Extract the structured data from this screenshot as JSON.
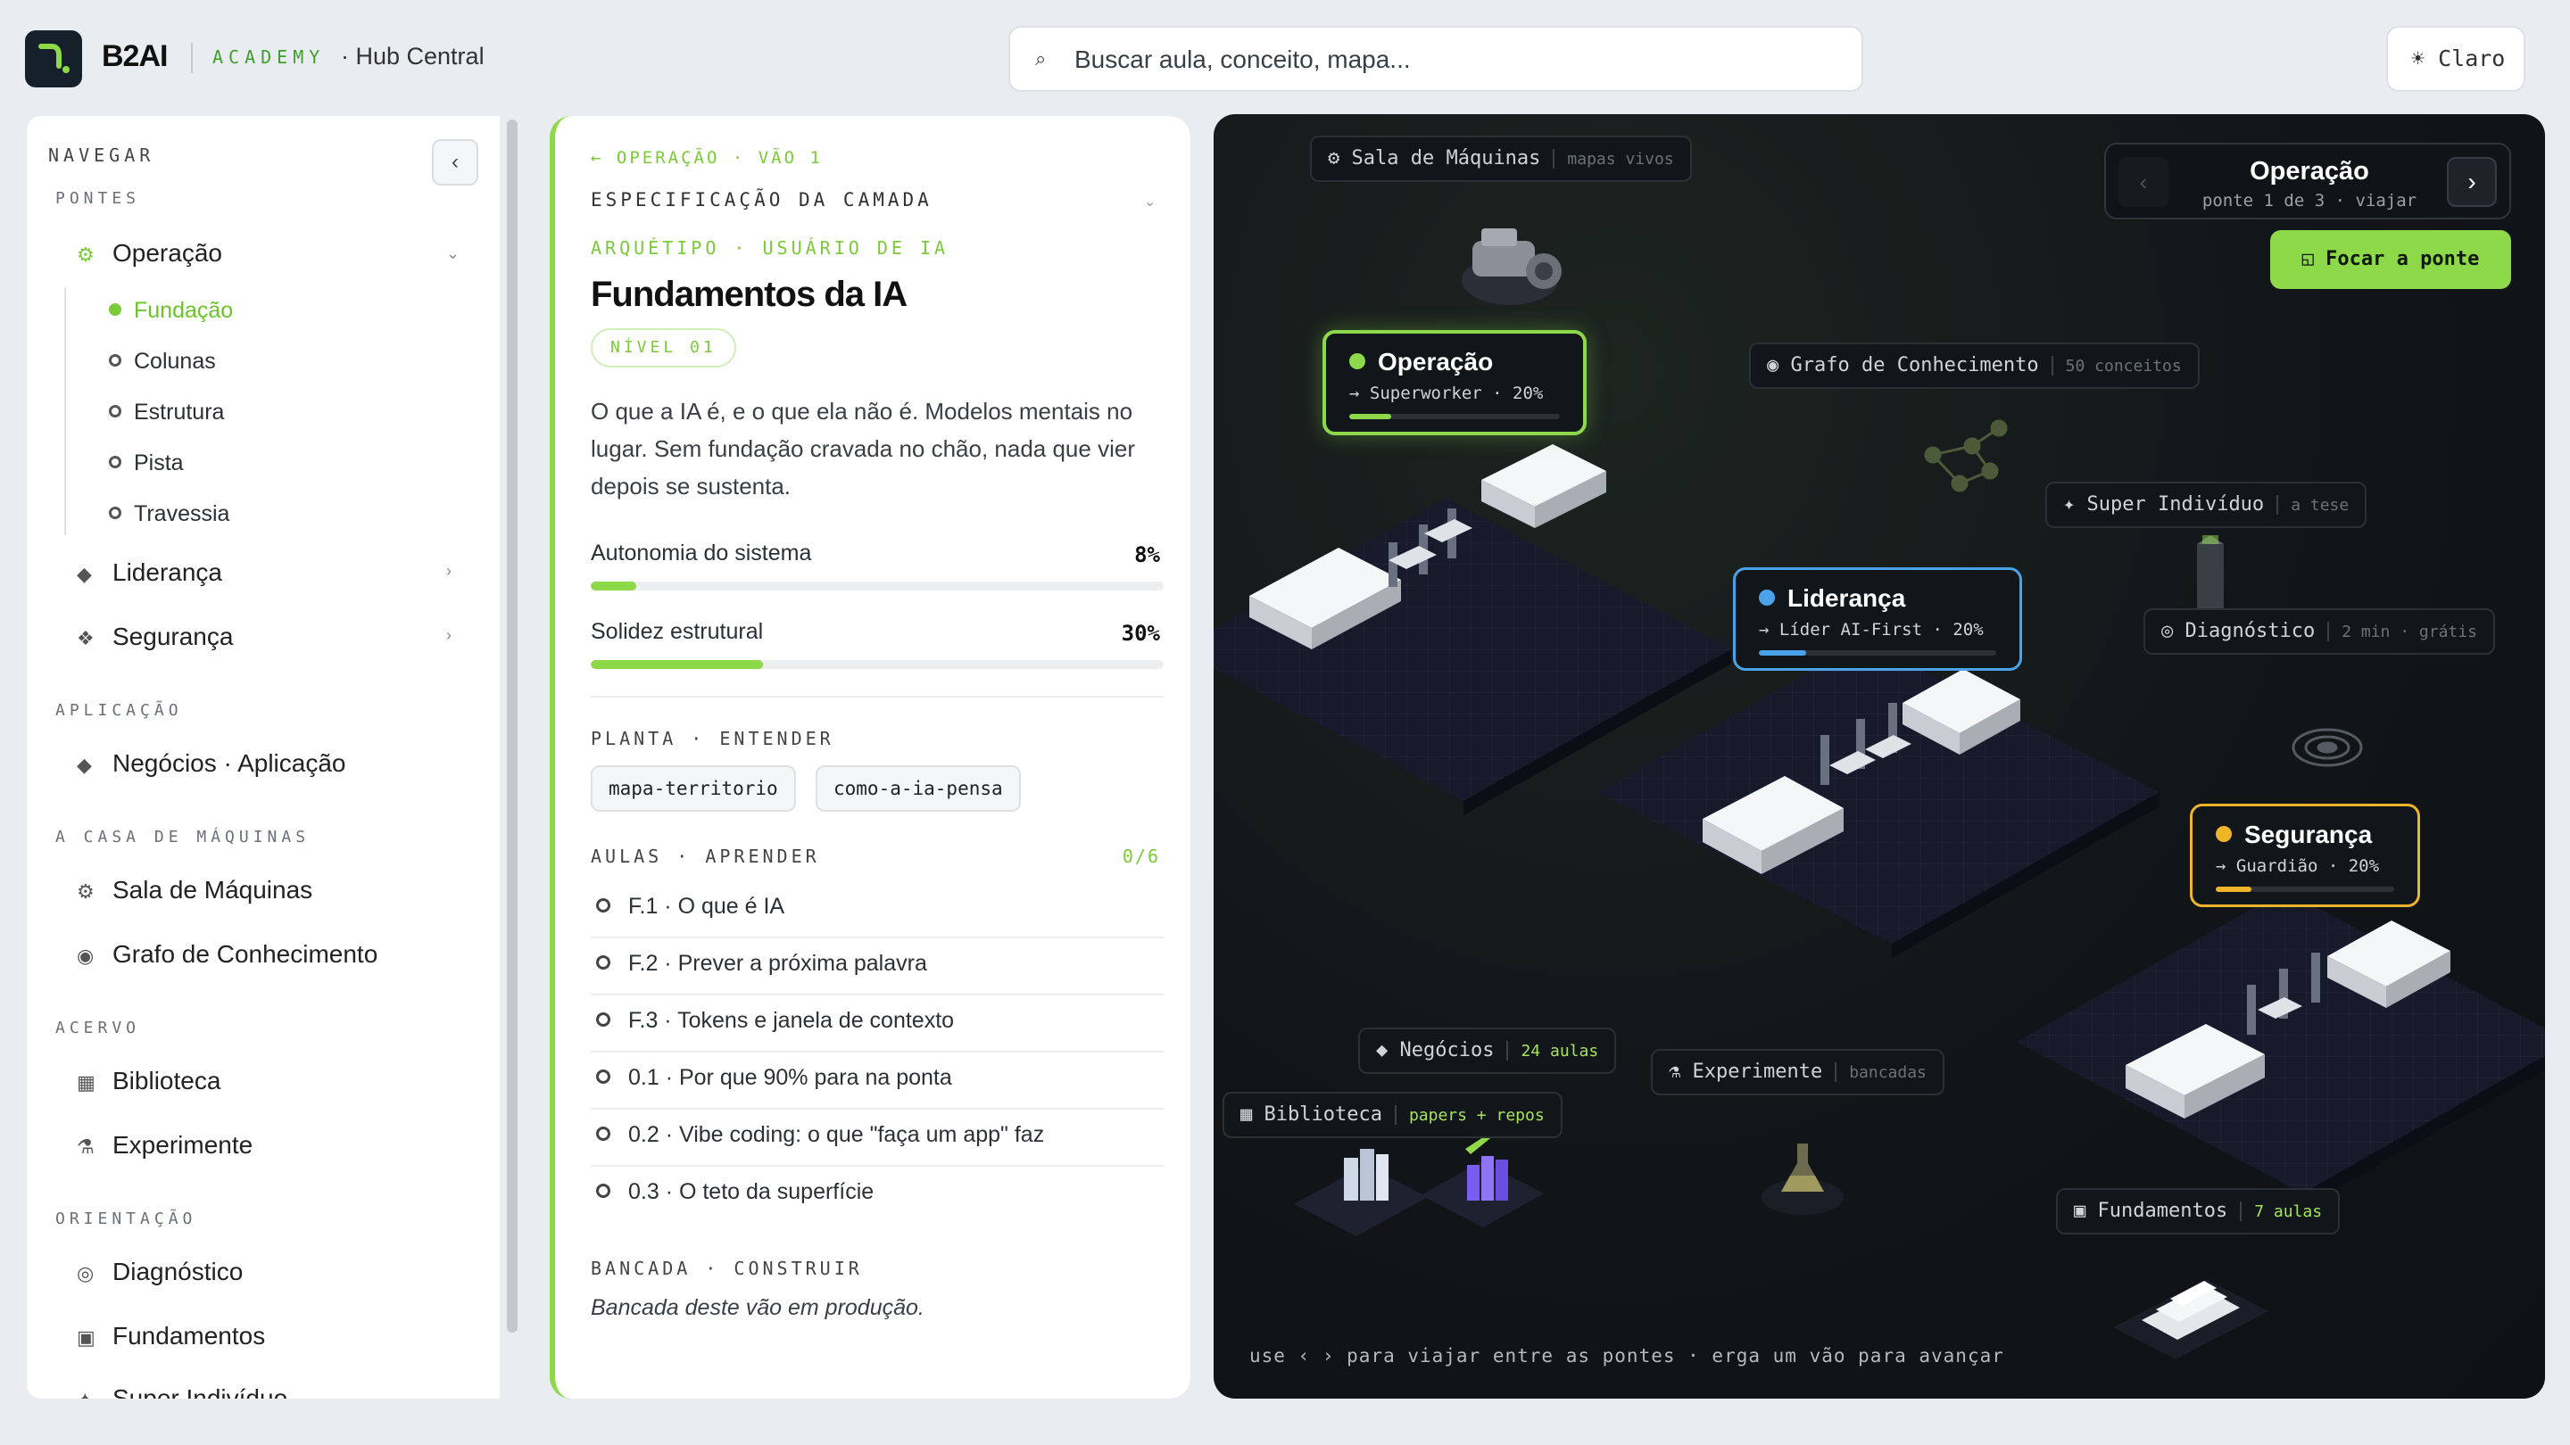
{
  "header": {
    "brand": "B2AI",
    "academy": "ACADEMY",
    "hub": "· Hub Central",
    "search_placeholder": "Buscar aula, conceito, mapa...",
    "theme_label": "☀ Claro"
  },
  "sidebar": {
    "title": "NAVEGAR",
    "sections": {
      "pontes": "PONTES",
      "aplicacao": "APLICAÇÃO",
      "casa": "A CASA DE MÁQUINAS",
      "acervo": "ACERVO",
      "orientacao": "ORIENTAÇÃO"
    },
    "items": {
      "operacao": "Operação",
      "lideranca": "Liderança",
      "seguranca": "Segurança",
      "negocios": "Negócios · Aplicação",
      "sala": "Sala de Máquinas",
      "grafo": "Grafo de Conhecimento",
      "biblioteca": "Biblioteca",
      "experimente": "Experimente",
      "diagnostico": "Diagnóstico",
      "fundamentos": "Fundamentos",
      "super": "Super Indivíduo"
    },
    "sub_items": [
      "Fundação",
      "Colunas",
      "Estrutura",
      "Pista",
      "Travessia"
    ]
  },
  "detail": {
    "kicker": "← OPERAÇÃO · VÃO 1",
    "spec": "ESPECIFICAÇÃO DA CAMADA",
    "archetype": "ARQUÉTIPO · USUÁRIO DE IA",
    "title": "Fundamentos da IA",
    "level": "NÍVEL 01",
    "description": "O que a IA é, e o que ela não é. Modelos mentais no lugar. Sem fundação cravada no chão, nada que vier depois se sustenta.",
    "metrics": [
      {
        "label": "Autonomia do sistema",
        "value": "8%",
        "fraction": 0.08
      },
      {
        "label": "Solidez estrutural",
        "value": "30%",
        "fraction": 0.3
      }
    ],
    "planta_title": "PLANTA · ENTENDER",
    "chips": [
      "mapa-territorio",
      "como-a-ia-pensa"
    ],
    "aulas_title": "AULAS · APRENDER",
    "aulas_count": "0/6",
    "lessons": [
      "F.1 · O que é IA",
      "F.2 · Prever a próxima palavra",
      "F.3 · Tokens e janela de contexto",
      "0.1 · Por que 90% para na ponta",
      "0.2 · Vibe coding: o que \"faça um app\" faz",
      "0.3 · O teto da superfície"
    ],
    "bancada_title": "BANCADA · CONSTRUIR",
    "bancada_note": "Bancada deste vão em produção."
  },
  "map": {
    "nav": {
      "prev": "‹",
      "next": "›",
      "title": "Operação",
      "subtitle": "ponte 1 de 3 · viajar"
    },
    "focus_button": "◱ Focar a ponte",
    "pills": {
      "sala": {
        "icon": "⚙",
        "label": "Sala de Máquinas",
        "sub": "mapas vivos"
      },
      "grafo": {
        "icon": "◉",
        "label": "Grafo de Conhecimento",
        "sub": "50 conceitos"
      },
      "super": {
        "icon": "✦",
        "label": "Super Indivíduo",
        "sub": "a tese"
      },
      "diag": {
        "icon": "◎",
        "label": "Diagnóstico",
        "sub": "2 min · grátis"
      },
      "negocios": {
        "icon": "◆",
        "label": "Negócios",
        "sub": "24 aulas"
      },
      "experimente": {
        "icon": "⚗",
        "label": "Experimente",
        "sub": "bancadas"
      },
      "biblioteca": {
        "icon": "▦",
        "label": "Biblioteca",
        "sub": "papers + repos"
      },
      "fundamentos": {
        "icon": "▣",
        "label": "Fundamentos",
        "sub": "7 aulas"
      }
    },
    "bridges": [
      {
        "name": "Operação",
        "role": "→ Superworker · 20%",
        "progress": 0.2,
        "color": "#8ed94a"
      },
      {
        "name": "Liderança",
        "role": "→ Líder AI-First · 20%",
        "progress": 0.2,
        "color": "#4aa3e8"
      },
      {
        "name": "Segurança",
        "role": "→ Guardião · 20%",
        "progress": 0.2,
        "color": "#f0b429"
      }
    ],
    "hint": "use ‹ › para viajar entre as pontes · erga um vão para avançar"
  }
}
